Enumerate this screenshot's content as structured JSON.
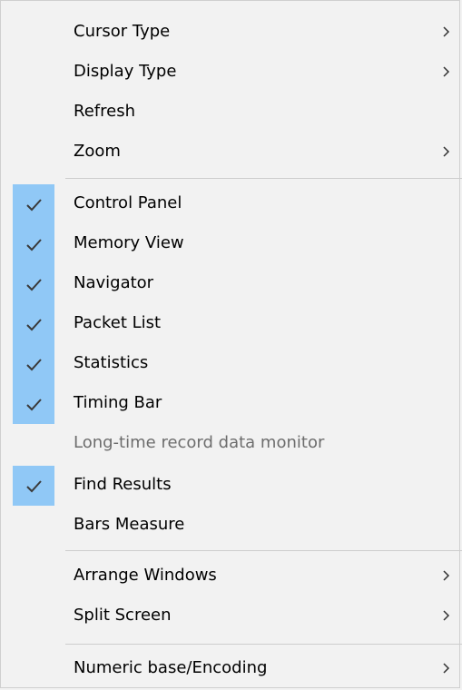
{
  "menu": {
    "items": [
      {
        "label": "Cursor Type",
        "has_submenu": true,
        "checked": false,
        "enabled": true
      },
      {
        "label": "Display Type",
        "has_submenu": true,
        "checked": false,
        "enabled": true
      },
      {
        "label": "Refresh",
        "has_submenu": false,
        "checked": false,
        "enabled": true
      },
      {
        "label": "Zoom",
        "has_submenu": true,
        "checked": false,
        "enabled": true
      },
      {
        "label": "Control Panel",
        "has_submenu": false,
        "checked": true,
        "enabled": true
      },
      {
        "label": "Memory View",
        "has_submenu": false,
        "checked": true,
        "enabled": true
      },
      {
        "label": "Navigator",
        "has_submenu": false,
        "checked": true,
        "enabled": true
      },
      {
        "label": "Packet List",
        "has_submenu": false,
        "checked": true,
        "enabled": true
      },
      {
        "label": "Statistics",
        "has_submenu": false,
        "checked": true,
        "enabled": true
      },
      {
        "label": "Timing Bar",
        "has_submenu": false,
        "checked": true,
        "enabled": true
      },
      {
        "label": "Long-time record data monitor",
        "has_submenu": false,
        "checked": false,
        "enabled": false
      },
      {
        "label": "Find Results",
        "has_submenu": false,
        "checked": true,
        "enabled": true
      },
      {
        "label": "Bars Measure",
        "has_submenu": false,
        "checked": false,
        "enabled": true
      },
      {
        "label": "Arrange Windows",
        "has_submenu": true,
        "checked": false,
        "enabled": true
      },
      {
        "label": "Split Screen",
        "has_submenu": true,
        "checked": false,
        "enabled": true
      },
      {
        "label": "Numeric base/Encoding",
        "has_submenu": true,
        "checked": false,
        "enabled": true
      }
    ]
  },
  "colors": {
    "menu_background": "#f2f2f2",
    "check_highlight": "#90c8f6",
    "check_mark": "#3a3a3a",
    "separator": "#cdcdcd",
    "disabled_text": "#6d6d6d"
  },
  "icons": {
    "checkmark": "checkmark-icon",
    "submenu": "chevron-right-icon"
  }
}
